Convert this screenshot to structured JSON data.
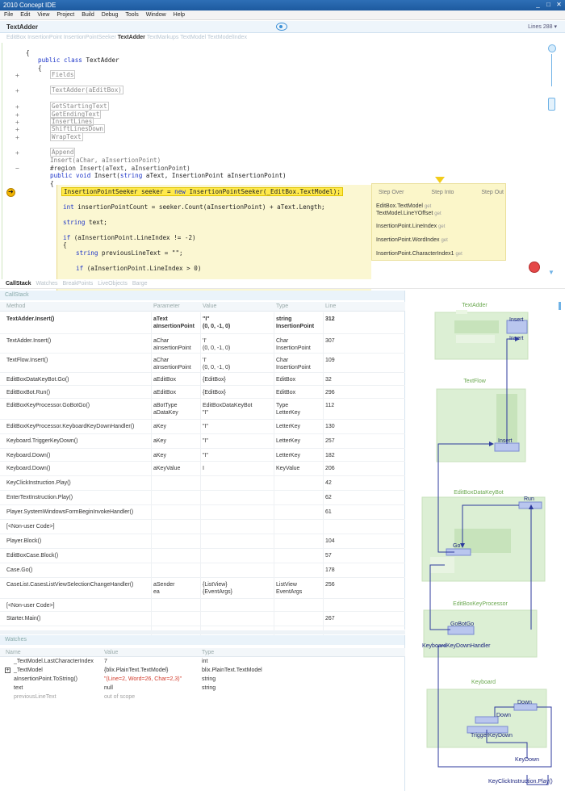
{
  "window": {
    "title": "2010 Concept IDE",
    "controls": [
      "_",
      "□",
      "✕"
    ]
  },
  "menu": [
    "File",
    "Edit",
    "View",
    "Project",
    "Build",
    "Debug",
    "Tools",
    "Window",
    "Help"
  ],
  "document": {
    "title": "TextAdder",
    "lines": "Lines 288"
  },
  "breadcrumb": {
    "before": "EditBox  InsertionPoint  InsertionPointSeeker",
    "current": "TextAdder",
    "after": "TextMarkups  TextModel  TextModelIndex"
  },
  "code": {
    "l1": "{",
    "l2a": "public class",
    "l2b": " TextAdder",
    "l3": "{",
    "fields": "Fields",
    "ctor": "TextAdder(aEditBox)",
    "m1": "GetStartingText",
    "m2": "GetEndingText",
    "m3": "InsertLines",
    "m4": "ShiftLinesDown",
    "m5": "WrapText",
    "append": "Append",
    "insertSig": "Insert(aChar, aInsertionPoint)",
    "region": "#region Insert(aText, aInsertionPoint)",
    "pubvoid": "public void",
    "insertDecl": " Insert(",
    "strKw": "string",
    "insertDecl2": " aText, InsertionPoint aInsertionPoint)",
    "brace": "{",
    "hlA": "InsertionPointSeeker seeker = ",
    "hlNew": "new",
    "hlB": " InsertionPointSeeker(_EditBox.TextModel);",
    "intKw": "int",
    "intLine": " insertionPointCount = seeker.Count(aInsertionPoint) + aText.Length;",
    "strKw2": "string",
    "strLine": " text;",
    "ifKw": "if",
    "ifLine": " (aInsertionPoint.LineIndex != -2)",
    "brace2": "{",
    "strKw3": "string",
    "prevLine": " previousLineText = \"\";",
    "ifKw2": "if",
    "ifLine2": " (aInsertionPoint.LineIndex > 0)"
  },
  "tooltip": {
    "stepOver": "Step Over",
    "stepInto": "Step Into",
    "stepOut": "Step Out",
    "i1": "EditBox.TextModel",
    "i2": "TextModel.LineYOffset",
    "i3": "InsertionPoint.LineIndex",
    "i4": "InsertionPoint.WordIndex",
    "i5": "InsertionPoint.CharacterIndex1",
    "get": "get"
  },
  "debugTabs": [
    "CallStack",
    "Watches",
    "BreakPoints",
    "LiveObjects",
    "Barge"
  ],
  "callstack": {
    "title": "CallStack",
    "headers": [
      "Method",
      "Parameter",
      "Value",
      "Type",
      "Line"
    ],
    "rows": [
      {
        "method": "TextAdder.Insert()",
        "param": "aText\naInsertionPoint",
        "value": "\"I\"\n(0, 0, -1, 0)",
        "type": "string\nInsertionPoint",
        "line": "312"
      },
      {
        "method": "TextAdder.Insert()",
        "param": "aChar\naInsertionPoint",
        "value": "'I'\n(0, 0, -1, 0)",
        "type": "Char\nInsertionPoint",
        "line": "307"
      },
      {
        "method": "TextFlow.Insert()",
        "param": "aChar\naInsertionPoint",
        "value": "'I'\n(0, 0, -1, 0)",
        "type": "Char\nInsertionPoint",
        "line": "109"
      },
      {
        "method": "EditBoxDataKeyBot.Go()",
        "param": "aEditBox",
        "value": "{EditBox}",
        "type": "EditBox",
        "line": "32"
      },
      {
        "method": "EditBoxBot.Run()",
        "param": "aEditBox",
        "value": "{EditBox}",
        "type": "EditBox",
        "line": "296"
      },
      {
        "method": "EditBoxKeyProcessor.GoBotGo()",
        "param": "aBotType\naDataKey",
        "value": "EditBoxDataKeyBot\n\"I\"",
        "type": "Type\nLetterKey",
        "line": "112"
      },
      {
        "method": "EditBoxKeyProcessor.KeyboardKeyDownHandler()",
        "param": "aKey",
        "value": "\"I\"",
        "type": "LetterKey",
        "line": "130"
      },
      {
        "method": "Keyboard.TriggerKeyDown()",
        "param": "aKey",
        "value": "\"I\"",
        "type": "LetterKey",
        "line": "257"
      },
      {
        "method": "Keyboard.Down()",
        "param": "aKey",
        "value": "\"I\"",
        "type": "LetterKey",
        "line": "182"
      },
      {
        "method": "Keyboard.Down()",
        "param": "aKeyValue",
        "value": "I",
        "type": "KeyValue",
        "line": "206"
      },
      {
        "method": "KeyClickInstruction.Play()",
        "param": "",
        "value": "",
        "type": "",
        "line": "42"
      },
      {
        "method": "EnterTextInstruction.Play()",
        "param": "",
        "value": "",
        "type": "",
        "line": "62"
      },
      {
        "method": "Player.SystemWindowsFormBeginInvokeHandler()",
        "param": "",
        "value": "",
        "type": "",
        "line": "61"
      },
      {
        "method": "[<Non-user Code>]",
        "param": "",
        "value": "",
        "type": "",
        "line": ""
      },
      {
        "method": "Player.Block()",
        "param": "",
        "value": "",
        "type": "",
        "line": "104"
      },
      {
        "method": "EditBoxCase.Block()",
        "param": "",
        "value": "",
        "type": "",
        "line": "57"
      },
      {
        "method": "Case.Go()",
        "param": "",
        "value": "",
        "type": "",
        "line": "178"
      },
      {
        "method": "CaseList.CasesListViewSelectionChangeHandler()",
        "param": "aSender\nea",
        "value": "{ListView}\n{EventArgs}",
        "type": "ListView\nEventArgs",
        "line": "256"
      },
      {
        "method": "[<Non-user Code>]",
        "param": "",
        "value": "",
        "type": "",
        "line": ""
      },
      {
        "method": "Starter.Main()",
        "param": "",
        "value": "",
        "type": "",
        "line": "267"
      }
    ]
  },
  "watches": {
    "title": "Watches",
    "headers": [
      "Name",
      "Value",
      "Type"
    ],
    "rows": [
      {
        "name": "_TextModel.LastCharacterIndex",
        "value": "7",
        "type": "int",
        "style": "normal"
      },
      {
        "name": "_TextModel",
        "value": "{blix.PlainText.TextModel}",
        "type": "blix.PlainText.TextModel",
        "style": "normal"
      },
      {
        "name": "aInsertionPoint.ToString()",
        "value": "\"(Line=2, Word=26, Char=2,3)\"",
        "type": "string",
        "style": "red"
      },
      {
        "name": "text",
        "value": "null",
        "type": "string",
        "style": "normal"
      },
      {
        "name": "previousLineText",
        "value": "out of scope",
        "type": "",
        "style": "grey"
      }
    ]
  },
  "diagram": {
    "nodes": [
      "TextAdder",
      "TextFlow",
      "EditBoxDataKeyBot",
      "EditBoxKeyProcessor",
      "Keyboard"
    ],
    "labels": {
      "insert1": "Insert",
      "insert2": "Insert",
      "insert3": "Insert",
      "run": "Run",
      "go": "Go",
      "goBotGo": "GoBotGo",
      "kbHandler": "KeyboardKeyDownHandler",
      "down1": "Down",
      "down2": "Down",
      "trigger": "TriggerKeyDown",
      "keyDown": "KeyDown",
      "keyClick": "KeyClickInstruction.Play()"
    },
    "colors": {
      "node": "#d8ecd0",
      "nodeLabel": "#6aa84f",
      "method": "#b9c6ee",
      "arrow": "#2d3a9c"
    }
  }
}
